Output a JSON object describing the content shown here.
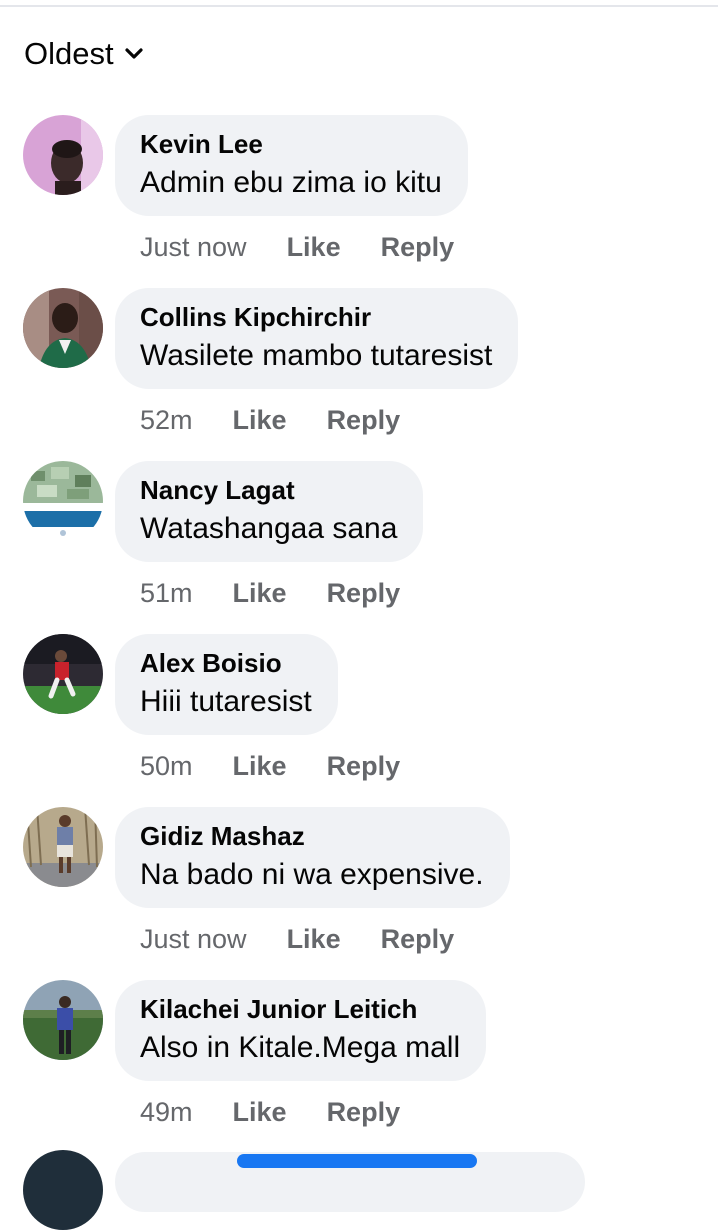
{
  "sort": {
    "label": "Oldest",
    "icon": "chevron-down-icon"
  },
  "comments": [
    {
      "author": "Kevin Lee",
      "text": "Admin ebu zima io kitu",
      "time": "Just now",
      "like_label": "Like",
      "reply_label": "Reply",
      "avatar_colors": [
        "#d8a3d6",
        "#3b2a2a"
      ]
    },
    {
      "author": "Collins Kipchirchir",
      "text": "Wasilete mambo tutaresist",
      "time": "52m",
      "like_label": "Like",
      "reply_label": "Reply",
      "avatar_colors": [
        "#7a5a55",
        "#1f6b48"
      ]
    },
    {
      "author": "Nancy Lagat",
      "text": "Watashangaa sana",
      "time": "51m",
      "like_label": "Like",
      "reply_label": "Reply",
      "avatar_colors": [
        "#9bb89a",
        "#1c6fa8"
      ]
    },
    {
      "author": "Alex Boisio",
      "text": "Hiii tutaresist",
      "time": "50m",
      "like_label": "Like",
      "reply_label": "Reply",
      "avatar_colors": [
        "#2d2a33",
        "#3f8a3a"
      ]
    },
    {
      "author": "Gidiz Mashaz",
      "text": "Na bado ni wa expensive.",
      "time": "Just now",
      "like_label": "Like",
      "reply_label": "Reply",
      "avatar_colors": [
        "#b7a98c",
        "#8a8b8f"
      ]
    },
    {
      "author": "Kilachei Junior Leitich",
      "text": "Also in Kitale.Mega mall",
      "time": "49m",
      "like_label": "Like",
      "reply_label": "Reply",
      "avatar_colors": [
        "#8fa3b5",
        "#3f6a35"
      ]
    }
  ],
  "colors": {
    "bubble": "#f0f2f5",
    "meta_text": "#65676b",
    "primary_text": "#050505",
    "accent": "#1877f2"
  }
}
